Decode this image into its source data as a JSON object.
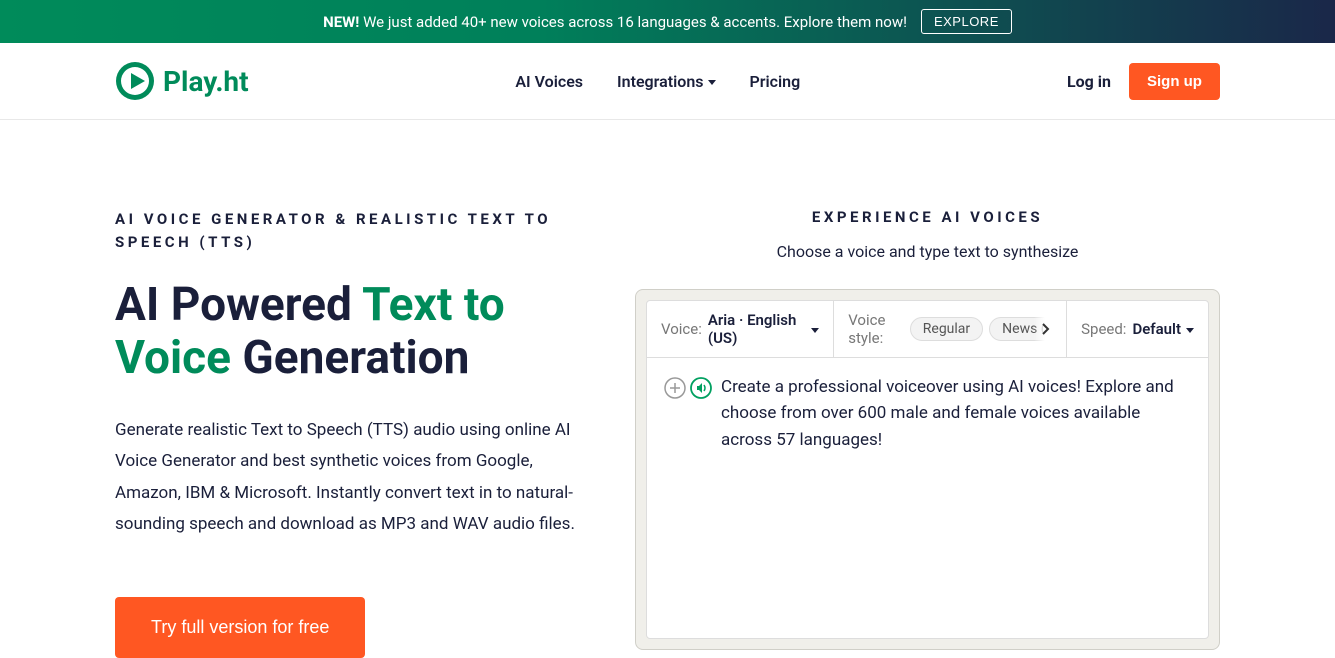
{
  "banner": {
    "new_label": "NEW!",
    "text": "We just added 40+ new voices across 16 languages & accents. Explore them now!",
    "button": "EXPLORE"
  },
  "nav": {
    "logo_text": "Play.ht",
    "links": {
      "ai_voices": "AI Voices",
      "integrations": "Integrations",
      "pricing": "Pricing"
    },
    "login": "Log in",
    "signup": "Sign up"
  },
  "hero": {
    "eyebrow": "AI VOICE GENERATOR & REALISTIC TEXT TO SPEECH (TTS)",
    "title_1": "AI Powered ",
    "title_green": "Text to Voice",
    "title_2": " Generation",
    "description": "Generate realistic Text to Speech (TTS) audio using online AI Voice Generator and best synthetic voices from Google, Amazon, IBM & Microsoft. Instantly convert text in to natural-sounding speech and download as MP3 and WAV audio files.",
    "cta": "Try full version for free"
  },
  "widget": {
    "eyebrow": "EXPERIENCE AI VOICES",
    "subtitle": "Choose a voice and type text to synthesize",
    "voice_label": "Voice:",
    "voice_value": "Aria · English (US)",
    "style_label": "Voice style:",
    "style_pill1": "Regular",
    "style_pill2": "News (formal)",
    "speed_label": "Speed:",
    "speed_value": "Default",
    "body_text": "Create a professional voiceover using AI voices! Explore and choose from over 600 male and female voices available across 57 languages!"
  }
}
